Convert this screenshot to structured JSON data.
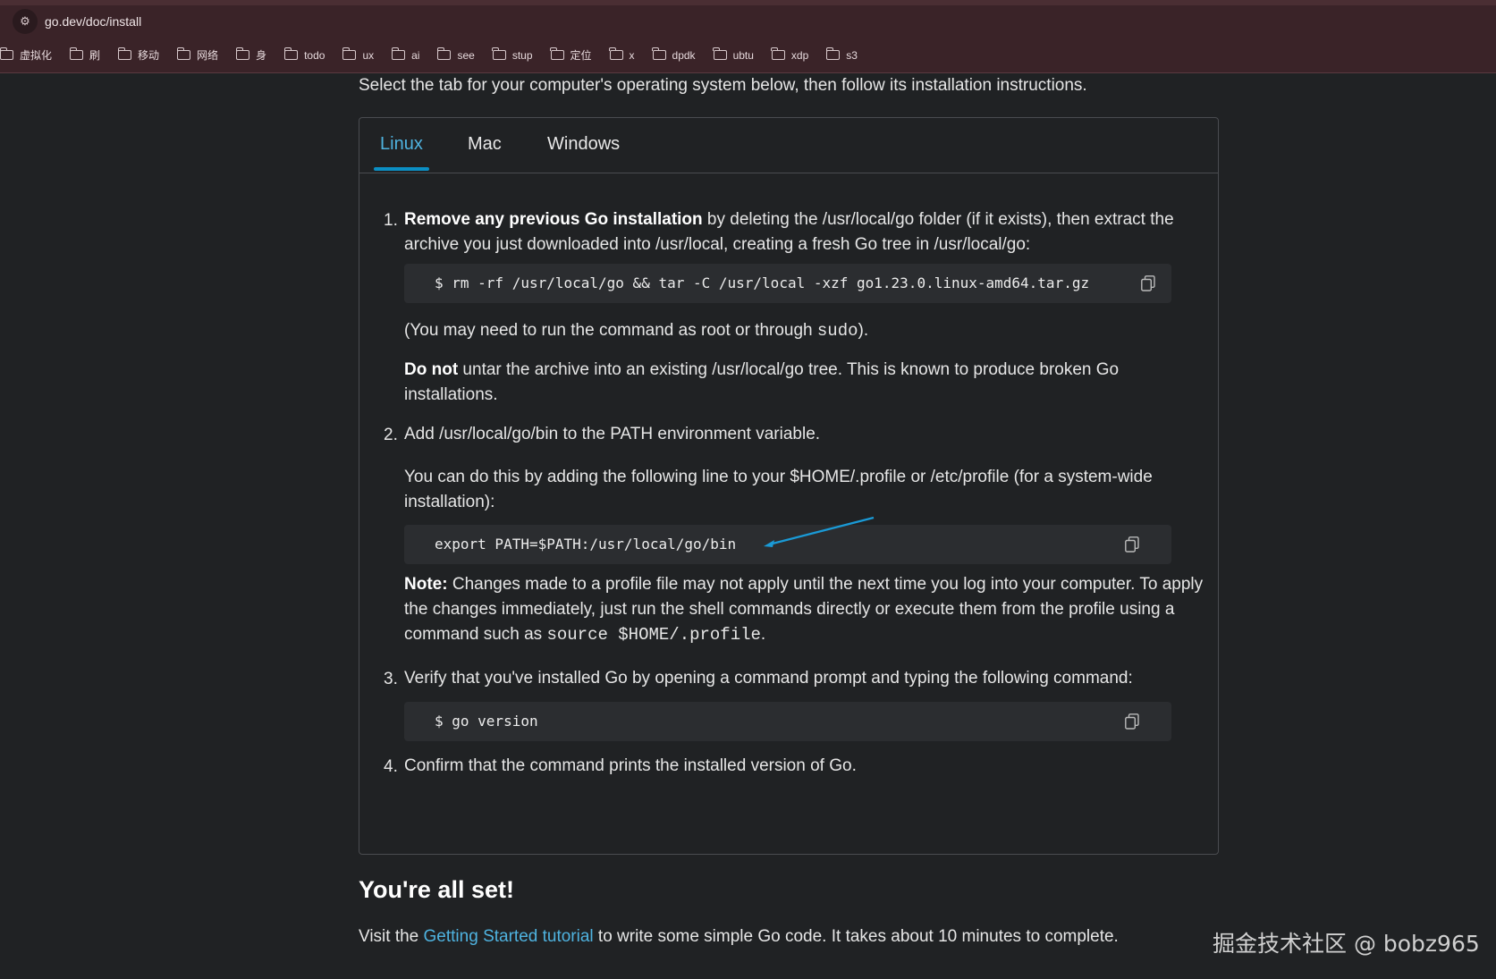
{
  "browser": {
    "url": "go.dev/doc/install",
    "bookmarks": [
      "虚拟化",
      "刷",
      "移动",
      "网络",
      "身",
      "todo",
      "ux",
      "ai",
      "see",
      "stup",
      "定位",
      "x",
      "dpdk",
      "ubtu",
      "xdp",
      "s3"
    ]
  },
  "intro": "Select the tab for your computer's operating system below, then follow its installation instructions.",
  "tabs": [
    {
      "label": "Linux"
    },
    {
      "label": "Mac"
    },
    {
      "label": "Windows"
    }
  ],
  "steps": {
    "s1": {
      "num": "1.",
      "bold": "Remove any previous Go installation",
      "text": " by deleting the /usr/local/go folder (if it exists), then extract the archive you just downloaded into /usr/local, creating a fresh Go tree in /usr/local/go:",
      "code": "$ rm -rf /usr/local/go && tar -C /usr/local -xzf go1.23.0.linux-amd64.tar.gz",
      "note_pre": "(You may need to run the command as root or through ",
      "note_code": "sudo",
      "note_post": ").",
      "warn_bold": "Do not",
      "warn_text": " untar the archive into an existing /usr/local/go tree. This is known to produce broken Go installations."
    },
    "s2": {
      "num": "2.",
      "text": "Add /usr/local/go/bin to the PATH environment variable.",
      "sub": "You can do this by adding the following line to your $HOME/.profile or /etc/profile (for a system-wide installation):",
      "code": "export PATH=$PATH:/usr/local/go/bin",
      "note_bold": "Note:",
      "note_text": " Changes made to a profile file may not apply until the next time you log into your computer. To apply the changes immediately, just run the shell commands directly or execute them from the profile using a command such as ",
      "note_code": "source $HOME/.profile",
      "note_post": "."
    },
    "s3": {
      "num": "3.",
      "text": "Verify that you've installed Go by opening a command prompt and typing the following command:",
      "code": "$ go version"
    },
    "s4": {
      "num": "4.",
      "text": "Confirm that the command prints the installed version of Go."
    }
  },
  "done": {
    "heading": "You're all set!",
    "visit_pre": "Visit the ",
    "link": "Getting Started tutorial",
    "visit_post": " to write some simple Go code. It takes about 10 minutes to complete."
  },
  "watermark": "掘金技术社区 @ bobz965",
  "colors": {
    "accent": "#4fb3e0",
    "tab_underline": "#0b8fc4",
    "annotation_arrow": "#1a9ad6"
  }
}
